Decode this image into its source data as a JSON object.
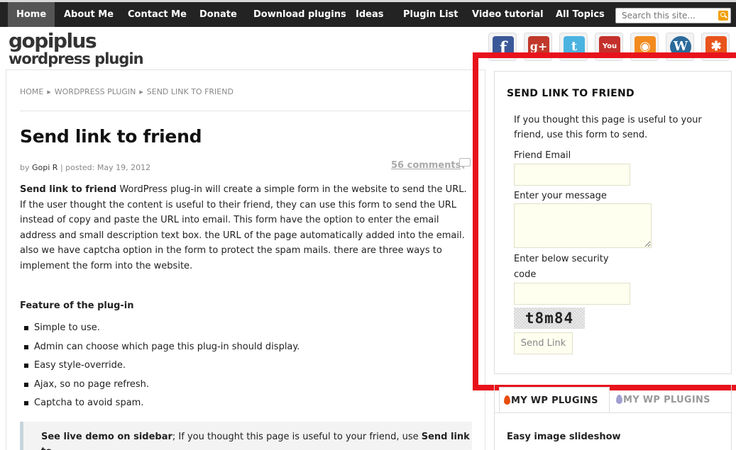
{
  "nav": {
    "items": [
      "Home",
      "About Me",
      "Contact Me",
      "Donate",
      "Download plugins",
      "Ideas",
      "Plugin List",
      "Video tutorial",
      "All Topics"
    ],
    "search_placeholder": "Search this site..."
  },
  "logo": {
    "line1": "gopiplus",
    "line2": "wordpress plugin"
  },
  "social": [
    {
      "name": "facebook-icon",
      "glyph": "f",
      "color": "#3b5998"
    },
    {
      "name": "google-plus-icon",
      "glyph": "g+",
      "color": "#c0392b"
    },
    {
      "name": "twitter-icon",
      "glyph": "t",
      "color": "#4bb3e0"
    },
    {
      "name": "youtube-icon",
      "glyph": "You",
      "color": "#c4302b"
    },
    {
      "name": "rss-icon",
      "glyph": "◉",
      "color": "#f28a1e"
    },
    {
      "name": "wordpress-icon",
      "glyph": "W",
      "color": "#2b6a9a"
    },
    {
      "name": "joomla-icon",
      "glyph": "✱",
      "color": "#e8541c"
    }
  ],
  "breadcrumb": [
    "HOME",
    "WORDPRESS PLUGIN",
    "SEND LINK TO FRIEND"
  ],
  "post": {
    "title": "Send link to friend",
    "meta_by": "by",
    "author": "Gopi R",
    "meta_sep": "|",
    "posted": "posted: May 19, 2012",
    "comments": "56 comments",
    "intro_bold": "Send link to friend",
    "intro_text": " WordPress plug-in will create a simple form in the website to send the URL. If the user thought the content is useful to their friend, they can use this form to send the URL instead of copy and paste the URL into email. This form have the option to enter the email address and small description text box. the URL of the page automatically added into the email. also we have captcha option in the form to protect the spam mails. there are three ways to implement the form into the website.",
    "features_title": "Feature of the plug-in",
    "features": [
      "Simple to use.",
      "Admin can choose which page this plug-in should display.",
      "Easy style-override.",
      "Ajax, so no page refresh.",
      "Captcha to avoid spam."
    ],
    "demo_bold": "See live demo on sidebar",
    "demo_text": "; If you thought this page is useful to your friend, use ",
    "demo_bold2": "Send link to"
  },
  "widget": {
    "title": "SEND LINK TO FRIEND",
    "description": "If you thought this page is useful to your friend, use this form to send.",
    "email_label": "Friend Email",
    "message_label": "Enter your message",
    "security_label_1": "Enter below security",
    "security_label_2": "code",
    "captcha_text": "t8m84",
    "send_button": "Send Link"
  },
  "tabs": {
    "active": "MY WP PLUGINS",
    "inactive": "MY WP PLUGINS",
    "first_item": "Easy image slideshow"
  },
  "colors": {
    "nav_bg": "#232323",
    "highlight": "#e8121c",
    "field_bg": "#fffff0"
  }
}
